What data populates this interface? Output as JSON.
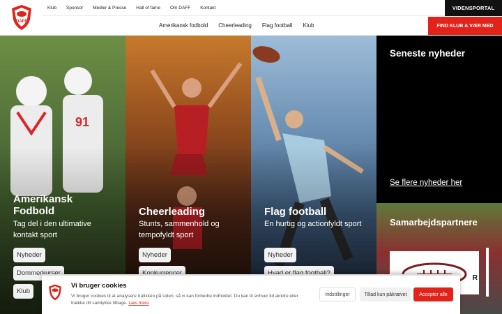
{
  "top_nav": [
    "Klub",
    "Sponsor",
    "Medier & Presse",
    "Hall of fame",
    "Om DAFF",
    "Kontakt"
  ],
  "videnportal_label": "VIDENSPORTAL",
  "main_nav": [
    "Amerikansk fodbold",
    "Cheerleading",
    "Flag football",
    "Klub"
  ],
  "find_klub_label": "FIND KLUB & VÆR MED",
  "logo_text": "DAFF",
  "panels": [
    {
      "title_line1": "Amerikansk",
      "title_line2": "Fodbold",
      "subtitle": "Tag del i den ultimative kontakt sport",
      "pills": [
        "Nyheder",
        "Dommerkurser",
        "Klub"
      ]
    },
    {
      "title": "Cheerleading",
      "subtitle": "Stunts, sammenhold og tempofyldt sport",
      "pills": [
        "Nyheder",
        "Konkurrencer"
      ]
    },
    {
      "title": "Flag football",
      "subtitle": "En hurtig og actionfyldt sport",
      "pills": [
        "Nyheder",
        "Hvad er flag football?"
      ]
    }
  ],
  "news": {
    "title": "Seneste nyheder",
    "link": "Se flere nyheder her"
  },
  "partners": {
    "title": "Samarbejdspartnere",
    "card_letter": "R"
  },
  "cookie": {
    "title": "Vi bruger cookies",
    "text": "Vi bruger cookies til at analysere trafikken på siden, så vi kan forbedre indholdet. Du kan til enhver tid ændre eller trække dit samtykke tilbage.",
    "link": "Læs mere",
    "btn_settings": "Indstillinger",
    "btn_required": "Tillad kun påkrævet",
    "btn_accept": "Accepter alle"
  },
  "colors": {
    "accent": "#e2231a",
    "dark": "#111111"
  }
}
